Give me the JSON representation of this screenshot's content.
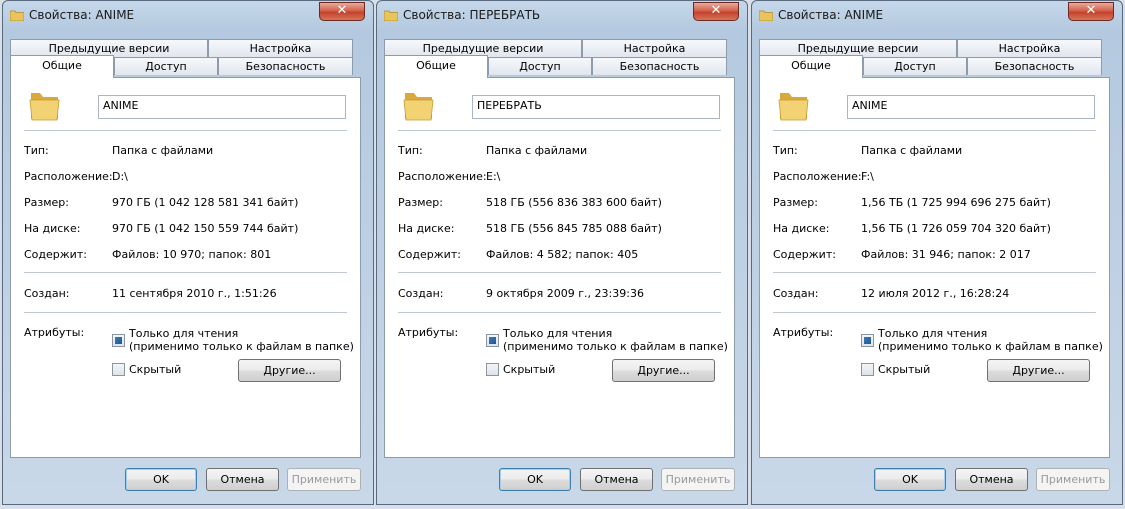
{
  "windows": [
    {
      "title": "Свойства: ANIME",
      "close_label": "✕",
      "tabs_row1": [
        "Предыдущие версии",
        "Настройка"
      ],
      "tabs_row2": [
        "Общие",
        "Доступ",
        "Безопасность"
      ],
      "name": "ANIME",
      "type_label": "Тип:",
      "type_value": "Папка с файлами",
      "location_label": "Расположение:",
      "location_value": "D:\\",
      "size_label": "Размер:",
      "size_value": "970 ГБ (1 042 128 581 341 байт)",
      "disk_label": "На диске:",
      "disk_value": "970 ГБ (1 042 150 559 744 байт)",
      "contains_label": "Содержит:",
      "contains_value": "Файлов: 10 970; папок: 801",
      "created_label": "Создан:",
      "created_value": "11 сентября 2010 г., 1:51:26",
      "attributes_label": "Атрибуты:",
      "readonly_label": "Только для чтения",
      "readonly_note": "(применимо только к файлам в папке)",
      "hidden_label": "Скрытый",
      "other_button": "Другие...",
      "ok": "OK",
      "cancel": "Отмена",
      "apply": "Применить"
    },
    {
      "title": "Свойства: ПЕРЕБРАТЬ",
      "close_label": "✕",
      "tabs_row1": [
        "Предыдущие версии",
        "Настройка"
      ],
      "tabs_row2": [
        "Общие",
        "Доступ",
        "Безопасность"
      ],
      "name": "ПЕРЕБРАТЬ",
      "type_label": "Тип:",
      "type_value": "Папка с файлами",
      "location_label": "Расположение:",
      "location_value": "E:\\",
      "size_label": "Размер:",
      "size_value": "518 ГБ (556 836 383 600 байт)",
      "disk_label": "На диске:",
      "disk_value": "518 ГБ (556 845 785 088 байт)",
      "contains_label": "Содержит:",
      "contains_value": "Файлов: 4 582; папок: 405",
      "created_label": "Создан:",
      "created_value": "9 октября 2009 г., 23:39:36",
      "attributes_label": "Атрибуты:",
      "readonly_label": "Только для чтения",
      "readonly_note": "(применимо только к файлам в папке)",
      "hidden_label": "Скрытый",
      "other_button": "Другие...",
      "ok": "OK",
      "cancel": "Отмена",
      "apply": "Применить"
    },
    {
      "title": "Свойства: ANIME",
      "close_label": "✕",
      "tabs_row1": [
        "Предыдущие версии",
        "Настройка"
      ],
      "tabs_row2": [
        "Общие",
        "Доступ",
        "Безопасность"
      ],
      "name": "ANIME",
      "type_label": "Тип:",
      "type_value": "Папка с файлами",
      "location_label": "Расположение:",
      "location_value": "F:\\",
      "size_label": "Размер:",
      "size_value": "1,56 ТБ (1 725 994 696 275 байт)",
      "disk_label": "На диске:",
      "disk_value": "1,56 ТБ (1 726 059 704 320 байт)",
      "contains_label": "Содержит:",
      "contains_value": "Файлов: 31 946; папок: 2 017",
      "created_label": "Создан:",
      "created_value": "12 июля 2012 г., 16:28:24",
      "attributes_label": "Атрибуты:",
      "readonly_label": "Только для чтения",
      "readonly_note": "(применимо только к файлам в папке)",
      "hidden_label": "Скрытый",
      "other_button": "Другие...",
      "ok": "OK",
      "cancel": "Отмена",
      "apply": "Применить"
    }
  ]
}
